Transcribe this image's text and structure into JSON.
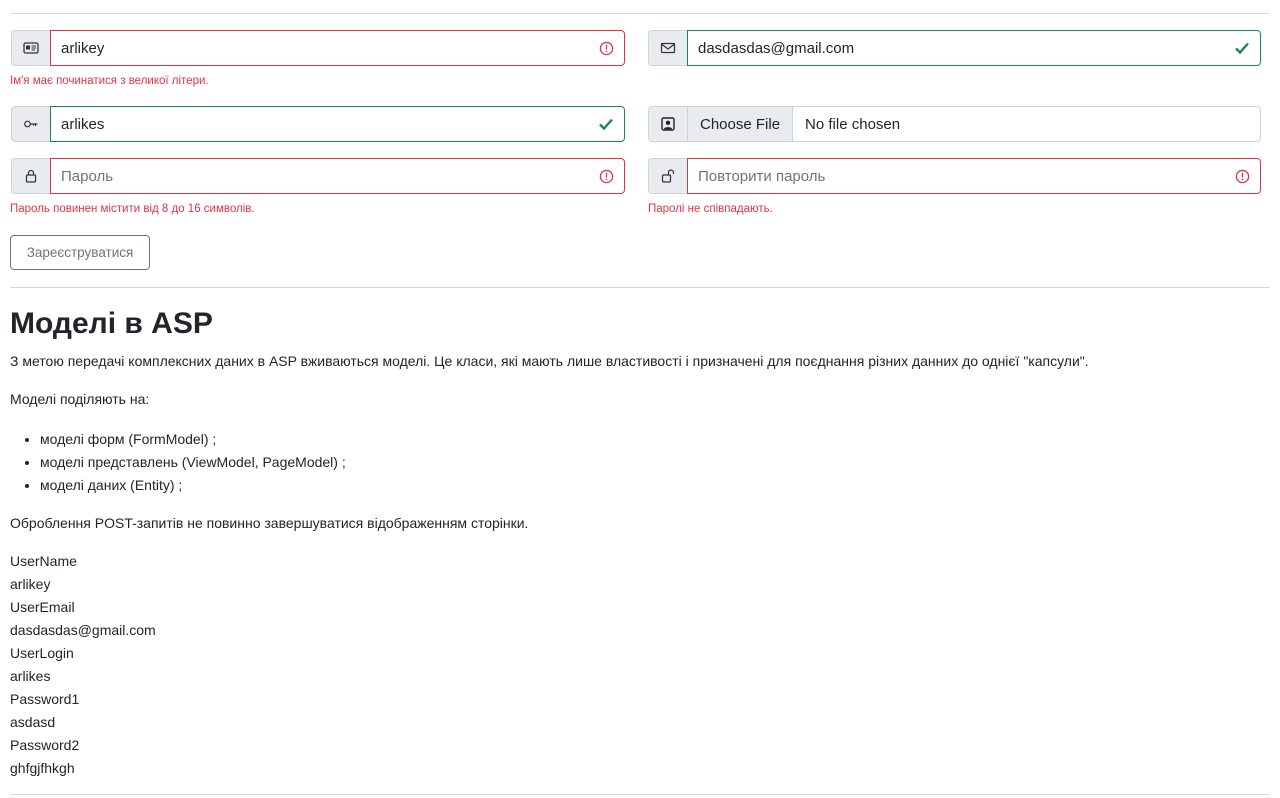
{
  "form": {
    "username": {
      "value": "arlikey",
      "error": "Ім'я має починатися з великої літери."
    },
    "email": {
      "value": "dasdasdas@gmail.com"
    },
    "login": {
      "value": "arlikes"
    },
    "file": {
      "button": "Choose File",
      "status": "No file chosen"
    },
    "password": {
      "placeholder": "Пароль",
      "error": "Пароль повинен містити від 8 до 16 символів."
    },
    "password_repeat": {
      "placeholder": "Повторити пароль",
      "error": "Паролі не співпадають."
    },
    "submit_label": "Зареєструватися"
  },
  "article": {
    "title": "Моделі в ASP",
    "intro": "З метою передачі комплексних даних в ASP вживаються моделі. Це класи, які мають лише властивості і призначені для поєднання різних данних до однієї \"капсули\".",
    "division": "Моделі поділяють на:",
    "items": [
      "моделі форм (FormModel) ;",
      "моделі представлень (ViewModel, PageModel) ;",
      "моделі даних (Entity) ;"
    ],
    "note": "Оброблення POST-запитів не повинно завершуватися відображенням сторінки."
  },
  "output": [
    "UserName",
    "arlikey",
    "UserEmail",
    "dasdasdas@gmail.com",
    "UserLogin",
    "arlikes",
    "Password1",
    "asdasd",
    "Password2",
    "ghfgjfhkgh"
  ],
  "colors": {
    "invalid": "#dc3545",
    "valid": "#198754"
  }
}
